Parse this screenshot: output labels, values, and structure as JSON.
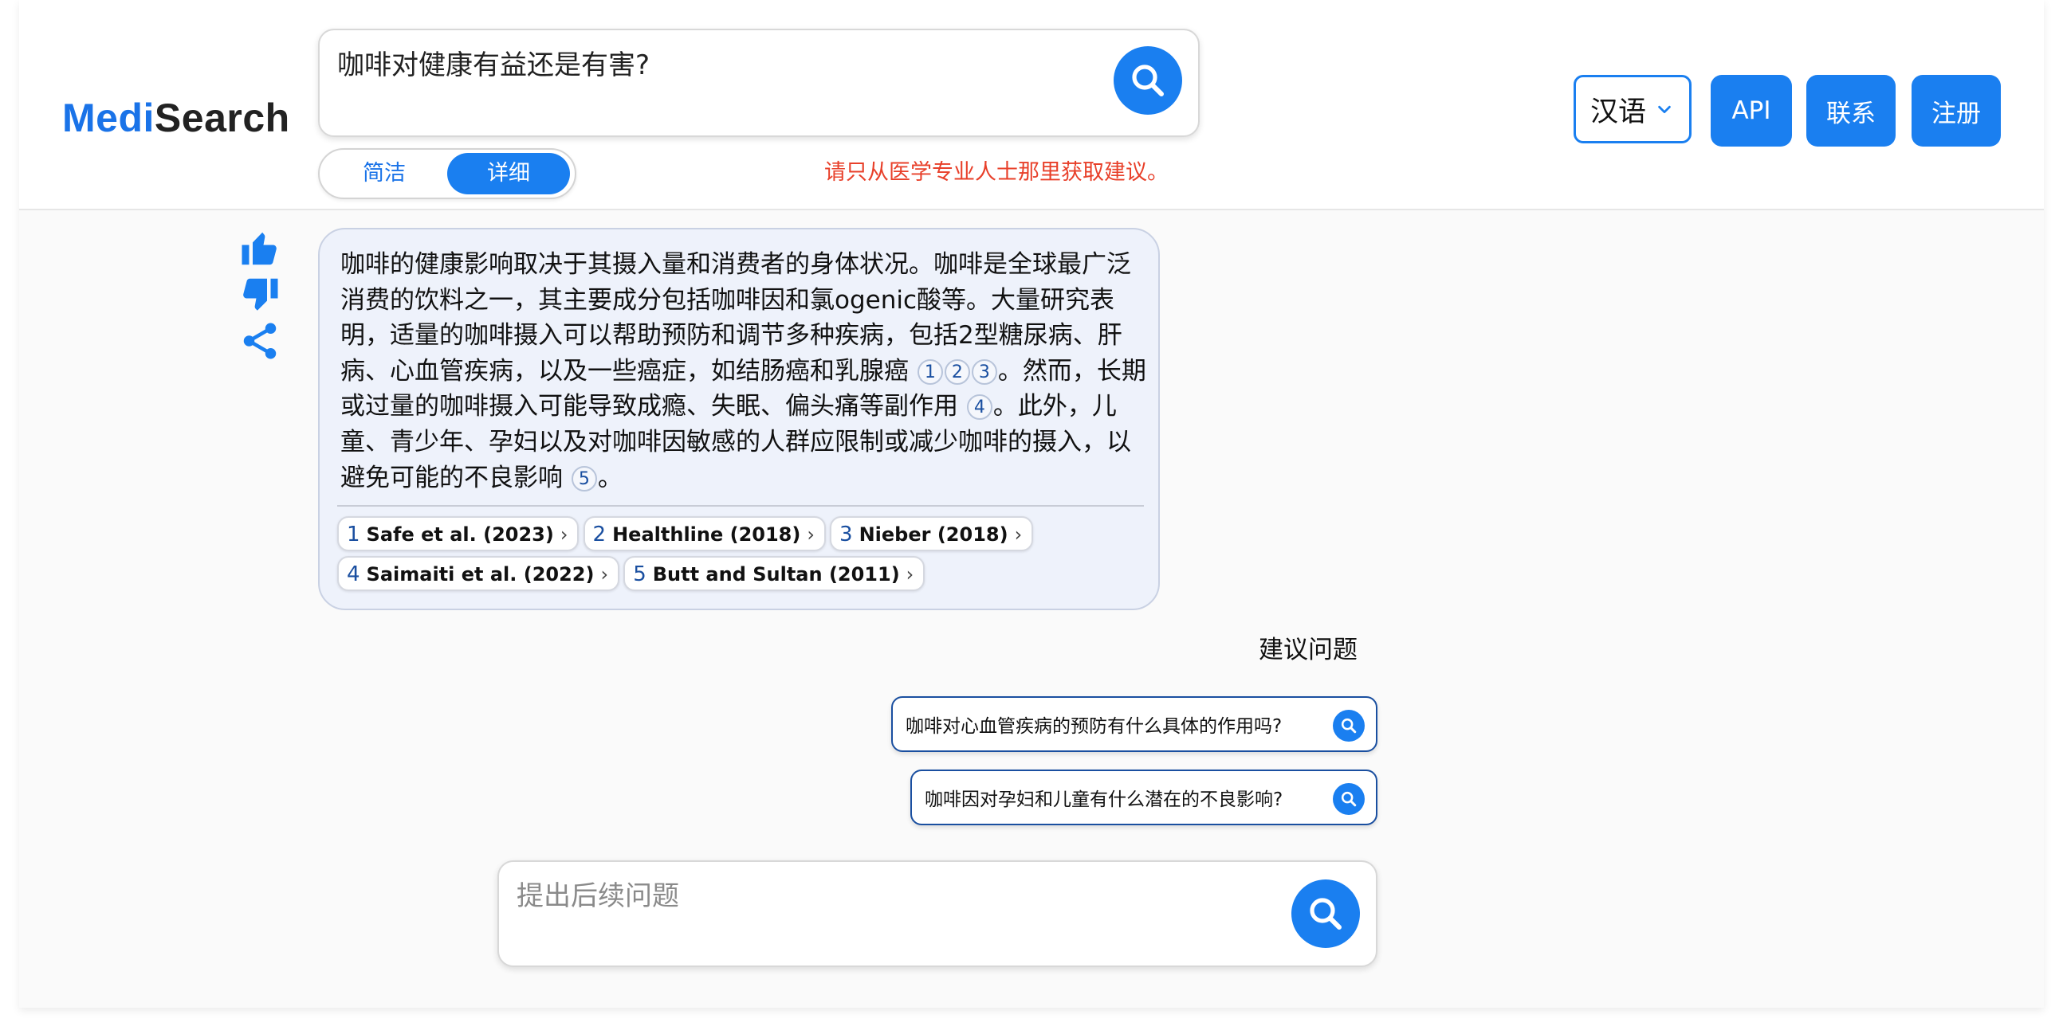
{
  "brand": {
    "medi": "Medi",
    "search": "Search"
  },
  "search": {
    "query": "咖啡对健康有益还是有害?"
  },
  "mode": {
    "concise": "简洁",
    "detailed": "详细",
    "selected": "详细"
  },
  "disclaimer": "请只从医学专业人士那里获取建议。",
  "nav": {
    "language": "汉语",
    "api": "API",
    "contact": "联系",
    "register": "注册"
  },
  "answer": {
    "p1": "咖啡的健康影响取决于其摄入量和消费者的身体状况。咖啡是全球最广泛消费的饮料之一，其主要成分包括咖啡因和氯ogenic酸等。大量研究表明，适量的咖啡摄入可以帮助预防和调节多种疾病，包括2型糖尿病、肝病、心血管疾病，以及一些癌症，如结肠癌和乳腺癌",
    "p2": "。然而，长期或过量的咖啡摄入可能导致成瘾、失眠、偏头痛等副作用",
    "p3": "。此外，儿童、青少年、孕妇以及对咖啡因敏感的人群应限制或减少咖啡的摄入，以避免可能的不良影响",
    "p4": "。",
    "cites": [
      "1",
      "2",
      "3",
      "4",
      "5"
    ]
  },
  "sources": [
    {
      "n": "1",
      "label": "Safe et al. (2023)"
    },
    {
      "n": "2",
      "label": "Healthline (2018)"
    },
    {
      "n": "3",
      "label": "Nieber (2018)"
    },
    {
      "n": "4",
      "label": "Saimaiti et al. (2022)"
    },
    {
      "n": "5",
      "label": "Butt and Sultan (2011)"
    }
  ],
  "suggestions": {
    "title": "建议问题",
    "items": [
      "咖啡对心血管疾病的预防有什么具体的作用吗?",
      "咖啡因对孕妇和儿童有什么潜在的不良影响?"
    ]
  },
  "followup": {
    "placeholder": "提出后续问题"
  },
  "icons": {
    "thumbs_up": "thumbs-up-icon",
    "thumbs_down": "thumbs-down-icon",
    "share": "share-icon",
    "search": "search-icon",
    "chevron": "chevron-down-icon"
  },
  "colors": {
    "accent": "#1a7ff0",
    "brand": "#1a73e8",
    "disclaimer": "#e8402a",
    "card_bg": "#eef2fb"
  }
}
